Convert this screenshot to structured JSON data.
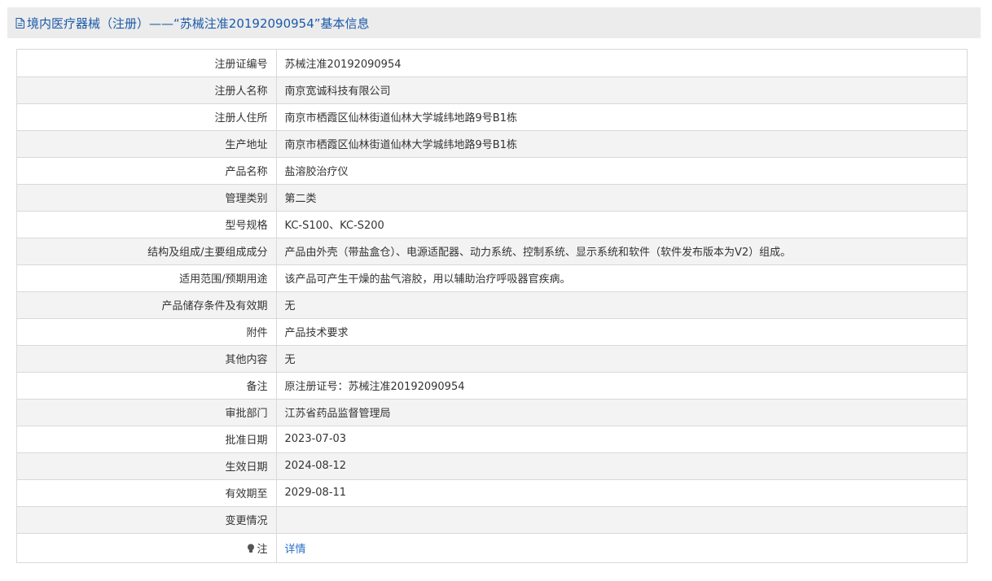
{
  "header": {
    "title": "境内医疗器械（注册）——“苏械注准20192090954”基本信息",
    "icon": "document-icon"
  },
  "rows": [
    {
      "label": "注册证编号",
      "value": "苏械注准20192090954"
    },
    {
      "label": "注册人名称",
      "value": "南京宽诚科技有限公司"
    },
    {
      "label": "注册人住所",
      "value": "南京市栖霞区仙林街道仙林大学城纬地路9号B1栋"
    },
    {
      "label": "生产地址",
      "value": "南京市栖霞区仙林街道仙林大学城纬地路9号B1栋"
    },
    {
      "label": "产品名称",
      "value": "盐溶胶治疗仪"
    },
    {
      "label": "管理类别",
      "value": "第二类"
    },
    {
      "label": "型号规格",
      "value": "KC-S100、KC-S200"
    },
    {
      "label": "结构及组成/主要组成成分",
      "value": "产品由外壳（带盐盒仓）、电源适配器、动力系统、控制系统、显示系统和软件（软件发布版本为V2）组成。"
    },
    {
      "label": "适用范围/预期用途",
      "value": "该产品可产生干燥的盐气溶胶，用以辅助治疗呼吸器官疾病。"
    },
    {
      "label": "产品储存条件及有效期",
      "value": "无"
    },
    {
      "label": "附件",
      "value": "产品技术要求"
    },
    {
      "label": "其他内容",
      "value": "无"
    },
    {
      "label": "备注",
      "value": "原注册证号：苏械注准20192090954"
    },
    {
      "label": "审批部门",
      "value": "江苏省药品监督管理局"
    },
    {
      "label": "批准日期",
      "value": "2023-07-03"
    },
    {
      "label": "生效日期",
      "value": "2024-08-12"
    },
    {
      "label": "有效期至",
      "value": "2029-08-11"
    },
    {
      "label": "变更情况",
      "value": ""
    }
  ],
  "note": {
    "label": "注",
    "link_text": "详情",
    "icon": "lightbulb-icon"
  },
  "colors": {
    "accent": "#1a5aa8",
    "link": "#2a6fc4",
    "header_bg": "#ececec",
    "row_alt": "#f3f3f3",
    "border": "#d9d9d9"
  }
}
